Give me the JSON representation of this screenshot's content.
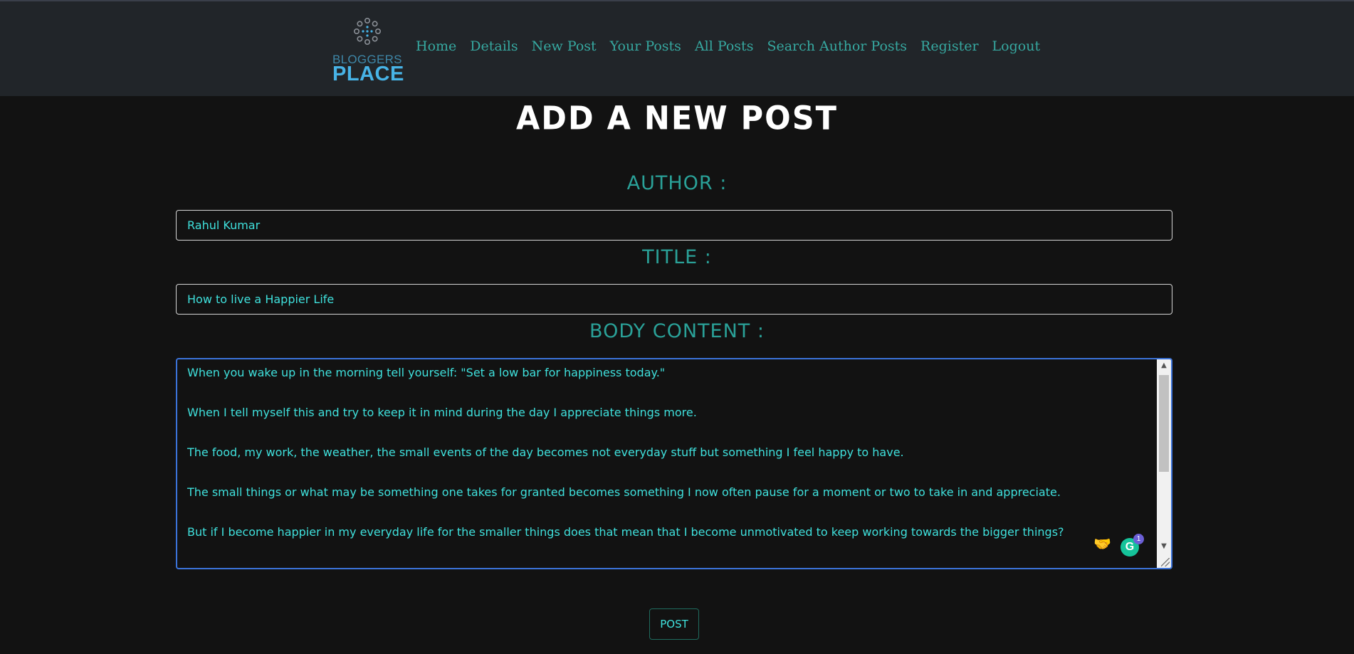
{
  "brand": {
    "line1": "BLOGGERS",
    "line2": "PLACE"
  },
  "nav": [
    {
      "label": "Home"
    },
    {
      "label": "Details"
    },
    {
      "label": "New Post"
    },
    {
      "label": "Your Posts"
    },
    {
      "label": "All Posts"
    },
    {
      "label": "Search Author Posts"
    },
    {
      "label": "Register"
    },
    {
      "label": "Logout"
    }
  ],
  "page": {
    "title": "ADD A NEW POST"
  },
  "form": {
    "author_label": "AUTHOR :",
    "author_value": "Rahul Kumar",
    "title_label": "TITLE :",
    "title_value": "How to live a Happier Life",
    "body_label": "BODY CONTENT :",
    "body_paragraphs": [
      "When you wake up in the morning tell yourself: \"Set a low bar for happiness today.\"",
      "When I tell myself this and try to keep it in mind during the day I appreciate things more.",
      "The food, my work, the weather, the small events of the day becomes not everyday stuff but something I feel happy to have.",
      "The small things or what may be something one takes for granted becomes something I now often pause for a moment or two to take in and appreciate.",
      "But if I become happier in my everyday life for the smaller things does that mean that I become unmotivated to keep working towards the bigger things?"
    ],
    "submit_label": "POST"
  },
  "extensions": {
    "grammarly_letter": "G",
    "grammarly_count": "1"
  }
}
